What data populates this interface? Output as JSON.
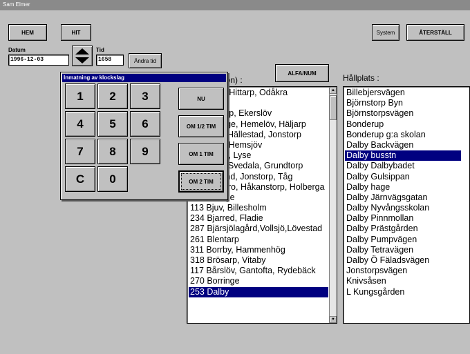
{
  "window": {
    "title": "Sam Elmer"
  },
  "toolbar": {
    "hem": "HEM",
    "hit": "HIT",
    "system": "System",
    "aterstall": "ÅTERSTÄLL"
  },
  "date": {
    "label": "Datum",
    "value": "1996-12-03"
  },
  "time": {
    "label": "Tid",
    "value": "1658",
    "change_label": "Ändra tid"
  },
  "area": {
    "title": "Område (zon) :",
    "sort_button": "ALFA/NUM",
    "items": [
      "… Påarp, Hittarp, Odåkra",
      "… Arild",
      "… Bjärnarp, Ekerslöv",
      "… Fjälkinge, Hemelöv, Häljarp",
      "… Dalby, Hällestad, Jonstorp",
      "… Västra Hemsjöv",
      "… Everöd, Lyse",
      "… Sjöbo, Svedala, Grundtorp",
      "… Furulund, Jonstorp, Tåg",
      "… Dösjebro, Håkanstorp, Holberga",
      "163 Billinge",
      "113 Bjuv, Billesholm",
      "234 Bjarred, Fladie",
      "287 Bjärsjölagård,Vollsjö,Lövestad",
      "261 Blentarp",
      "311 Borrby, Hammenhög",
      "318 Brösarp, Vitaby",
      "117 Bårslöv, Gantofta, Rydebäck",
      "270 Borringe",
      "253 Dalby"
    ],
    "selected_index": 19
  },
  "stop": {
    "title": "Hållplats :",
    "items": [
      "Billebjersvägen",
      "Björnstorp Byn",
      "Björnstorpsvägen",
      "Bonderup",
      "Bonderup g:a skolan",
      "Dalby Backvägen",
      "Dalby busstn",
      "Dalby Dalbybadet",
      "Dalby Gulsippan",
      "Dalby hage",
      "Dalby Järnvägsgatan",
      "Dalby Nyvångsskolan",
      "Dalby Pinnmollan",
      "Dalby Prästgården",
      "Dalby Pumpvägen",
      "Dalby Tetravägen",
      "Dalby Ö Fäladsvägen",
      "Jonstorpsvägen",
      "Knivsåsen",
      "L Kungsgården"
    ],
    "selected_index": 6
  },
  "clock_dialog": {
    "title": "Inmatning av klockslag",
    "keys": [
      "1",
      "2",
      "3",
      "4",
      "5",
      "6",
      "7",
      "8",
      "9",
      "C",
      "0"
    ],
    "actions": [
      "NU",
      "OM 1/2 TIM",
      "OM 1 TIM",
      "OM 2 TIM"
    ],
    "active_action_index": 3
  }
}
